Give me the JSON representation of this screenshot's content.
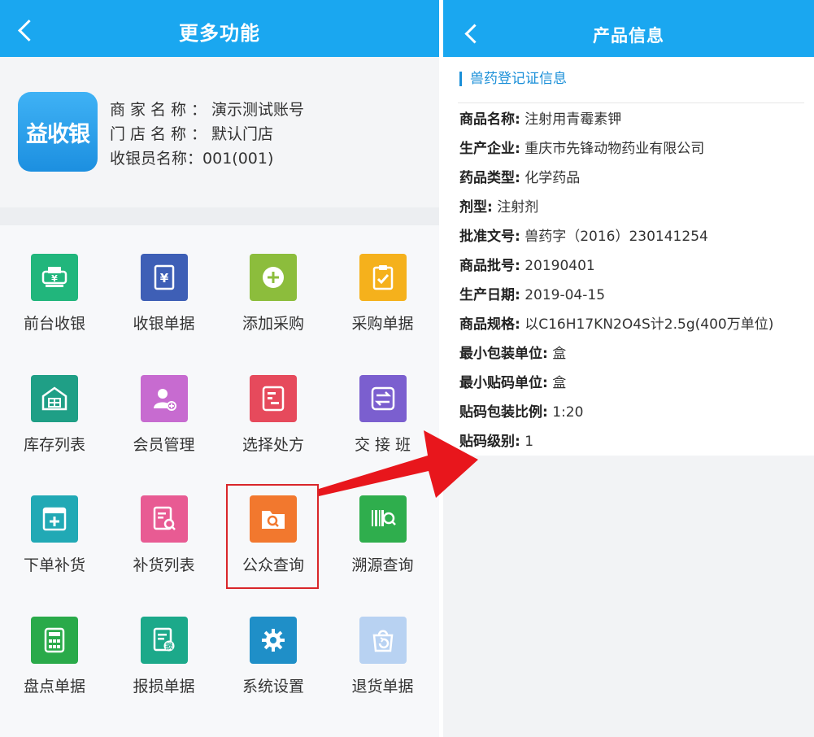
{
  "left": {
    "title": "更多功能",
    "merchant": {
      "logo_text": "益收银",
      "store_name_label": "商家名称：",
      "store_name_value": "演示测试账号",
      "shop_label": "门店名称：",
      "shop_value": "默认门店",
      "cashier_label": "收银员名称：",
      "cashier_value": "001(001)"
    },
    "tiles": [
      {
        "label": "前台收银",
        "icon": "cashier-icon",
        "color": "#21b67c"
      },
      {
        "label": "收银单据",
        "icon": "yen-receipt-icon",
        "color": "#3e5fb6"
      },
      {
        "label": "添加采购",
        "icon": "plus-circle-icon",
        "color": "#8cbd3c"
      },
      {
        "label": "采购单据",
        "icon": "clipboard-check-icon",
        "color": "#f5b11c"
      },
      {
        "label": "库存列表",
        "icon": "warehouse-icon",
        "color": "#1f9f86"
      },
      {
        "label": "会员管理",
        "icon": "member-add-icon",
        "color": "#c76bd0"
      },
      {
        "label": "选择处方",
        "icon": "prescription-icon",
        "color": "#e64a5c"
      },
      {
        "label": "交 接 班",
        "icon": "swap-icon",
        "color": "#7b5fcf"
      },
      {
        "label": "下单补货",
        "icon": "add-order-icon",
        "color": "#21a9b5"
      },
      {
        "label": "补货列表",
        "icon": "list-search-icon",
        "color": "#e85b93"
      },
      {
        "label": "公众查询",
        "icon": "folder-search-icon",
        "color": "#f2782e"
      },
      {
        "label": "溯源查询",
        "icon": "barcode-search-icon",
        "color": "#2fae4d"
      },
      {
        "label": "盘点单据",
        "icon": "calculator-icon",
        "color": "#2aaa4a"
      },
      {
        "label": "报损单据",
        "icon": "damage-report-icon",
        "color": "#1ca98a"
      },
      {
        "label": "系统设置",
        "icon": "gear-icon",
        "color": "#1f8fc8"
      },
      {
        "label": "退货单据",
        "icon": "return-bag-icon",
        "color": "#b8d2f2"
      }
    ]
  },
  "right": {
    "title": "产品信息",
    "section_title": "兽药登记证信息",
    "fields": [
      {
        "key": "商品名称:",
        "value": "注射用青霉素钾"
      },
      {
        "key": "生产企业:",
        "value": "重庆市先锋动物药业有限公司"
      },
      {
        "key": "药品类型:",
        "value": "化学药品"
      },
      {
        "key": "剂型:",
        "value": "注射剂"
      },
      {
        "key": "批准文号:",
        "value": "兽药字（2016）230141254"
      },
      {
        "key": "商品批号:",
        "value": "20190401"
      },
      {
        "key": "生产日期:",
        "value": "2019-04-15"
      },
      {
        "key": "商品规格:",
        "value": "以C16H17KN2O4S计2.5g(400万单位)"
      },
      {
        "key": "最小包装单位:",
        "value": "盒"
      },
      {
        "key": "最小贴码单位:",
        "value": "盒"
      },
      {
        "key": "贴码包装比例:",
        "value": "1:20"
      },
      {
        "key": "贴码级别:",
        "value": "1"
      }
    ]
  },
  "colors": {
    "header": "#1aa7f0",
    "highlight": "#d9262a",
    "arrow": "#e8161c"
  }
}
